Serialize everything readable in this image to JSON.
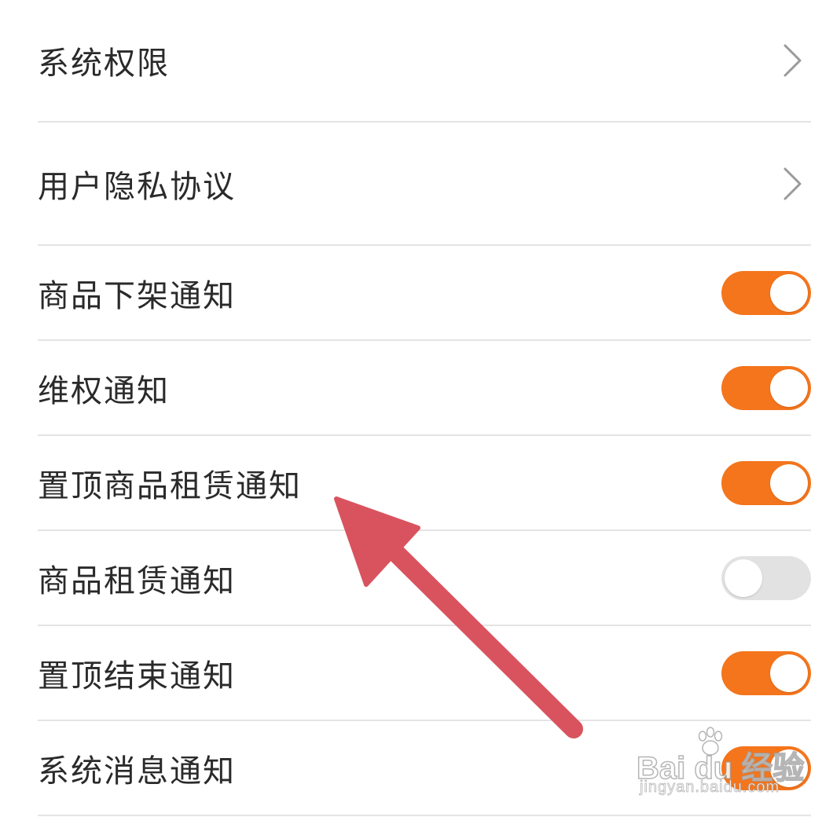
{
  "settings": {
    "rows": [
      {
        "label": "系统权限",
        "control": "chevron"
      },
      {
        "label": "用户隐私协议",
        "control": "chevron"
      },
      {
        "label": "商品下架通知",
        "control": "toggle",
        "on": true
      },
      {
        "label": "维权通知",
        "control": "toggle",
        "on": true
      },
      {
        "label": "置顶商品租赁通知",
        "control": "toggle",
        "on": true
      },
      {
        "label": "商品租赁通知",
        "control": "toggle",
        "on": false
      },
      {
        "label": "置顶结束通知",
        "control": "toggle",
        "on": true
      },
      {
        "label": "系统消息通知",
        "control": "toggle",
        "on": true
      }
    ]
  },
  "colors": {
    "toggle_on": "#f4751c",
    "toggle_off": "#e2e2e2",
    "annotation_arrow": "#d9535f"
  },
  "watermark": {
    "brand": "Bai du 经验",
    "url": "jingyan.baidu.com"
  }
}
